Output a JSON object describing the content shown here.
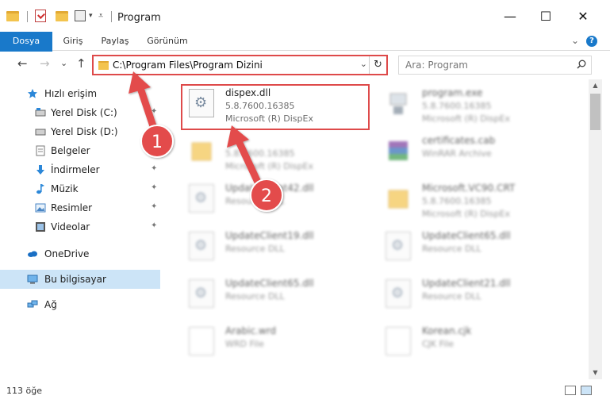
{
  "window": {
    "title": "Program",
    "minimize_glyph": "—",
    "maximize_glyph": "☐",
    "close_glyph": "✕"
  },
  "ribbon": {
    "tabs": [
      "Dosya",
      "Giriş",
      "Paylaş",
      "Görünüm"
    ],
    "help_glyph": "?",
    "expand_glyph": "⌄"
  },
  "navigation": {
    "back_glyph": "←",
    "forward_glyph": "→",
    "recent_glyph": "⌄",
    "up_glyph": "↑"
  },
  "address": {
    "path": "C:\\Program Files\\Program Dizini",
    "dropdown_glyph": "⌄",
    "refresh_glyph": "↻"
  },
  "search": {
    "placeholder": "Ara: Program"
  },
  "sidebar": {
    "items": [
      {
        "label": "Hızlı erişim",
        "icon": "star-icon"
      },
      {
        "label": "Yerel Disk (C:)",
        "icon": "drive-icon"
      },
      {
        "label": "Yerel Disk (D:)",
        "icon": "drive-icon"
      },
      {
        "label": "Belgeler",
        "icon": "documents-icon"
      },
      {
        "label": "İndirmeler",
        "icon": "download-icon"
      },
      {
        "label": "Müzik",
        "icon": "music-icon"
      },
      {
        "label": "Resimler",
        "icon": "pictures-icon"
      },
      {
        "label": "Videolar",
        "icon": "videos-icon"
      },
      {
        "label": "OneDrive",
        "icon": "cloud-icon"
      },
      {
        "label": "Bu bilgisayar",
        "icon": "computer-icon"
      },
      {
        "label": "Ağ",
        "icon": "network-icon"
      }
    ],
    "pin_glyph": "📌"
  },
  "files": [
    {
      "name": "dispex.dll",
      "line1": "5.8.7600.16385",
      "line2": "Microsoft (R) DispEx",
      "icon": "dll-gear-icon",
      "highlighted": true
    },
    {
      "name": "program.exe",
      "line1": "5.8.7600.16385",
      "line2": "Microsoft (R) DispEx",
      "icon": "exe-icon",
      "blurred": true
    },
    {
      "name": "",
      "line1": "5.8.7600.16385",
      "line2": "Microsoft (R) DispEx",
      "icon": "folder-icon",
      "blurred": true
    },
    {
      "name": "certificates.cab",
      "line1": "WinRAR Archive",
      "line2": "",
      "icon": "archive-icon",
      "blurred": true
    },
    {
      "name": "UpdateClient42.dll",
      "line1": "Resource DLL",
      "line2": "",
      "icon": "dll-icon",
      "blurred": true
    },
    {
      "name": "Microsoft.VC90.CRT",
      "line1": "5.8.7600.16385",
      "line2": "Microsoft (R) DispEx",
      "icon": "folder-icon",
      "blurred": true
    },
    {
      "name": "UpdateClient19.dll",
      "line1": "Resource DLL",
      "line2": "",
      "icon": "dll-icon",
      "blurred": true
    },
    {
      "name": "UpdateClient65.dll",
      "line1": "Resource DLL",
      "line2": "",
      "icon": "dll-icon",
      "blurred": true
    },
    {
      "name": "UpdateClient65.dll",
      "line1": "Resource DLL",
      "line2": "",
      "icon": "dll-icon",
      "blurred": true
    },
    {
      "name": "UpdateClient21.dll",
      "line1": "Resource DLL",
      "line2": "",
      "icon": "dll-icon",
      "blurred": true
    },
    {
      "name": "Arabic.wrd",
      "line1": "WRD File",
      "line2": "",
      "icon": "file-icon",
      "blurred": true
    },
    {
      "name": "Korean.cjk",
      "line1": "CJK File",
      "line2": "",
      "icon": "file-icon",
      "blurred": true
    }
  ],
  "status": {
    "item_count": "113 öğe"
  },
  "annotations": [
    {
      "number": "1"
    },
    {
      "number": "2"
    }
  ],
  "colors": {
    "accent": "#1979ca",
    "highlight_red": "#de4a4a",
    "selected_nav": "#cce4f7"
  }
}
